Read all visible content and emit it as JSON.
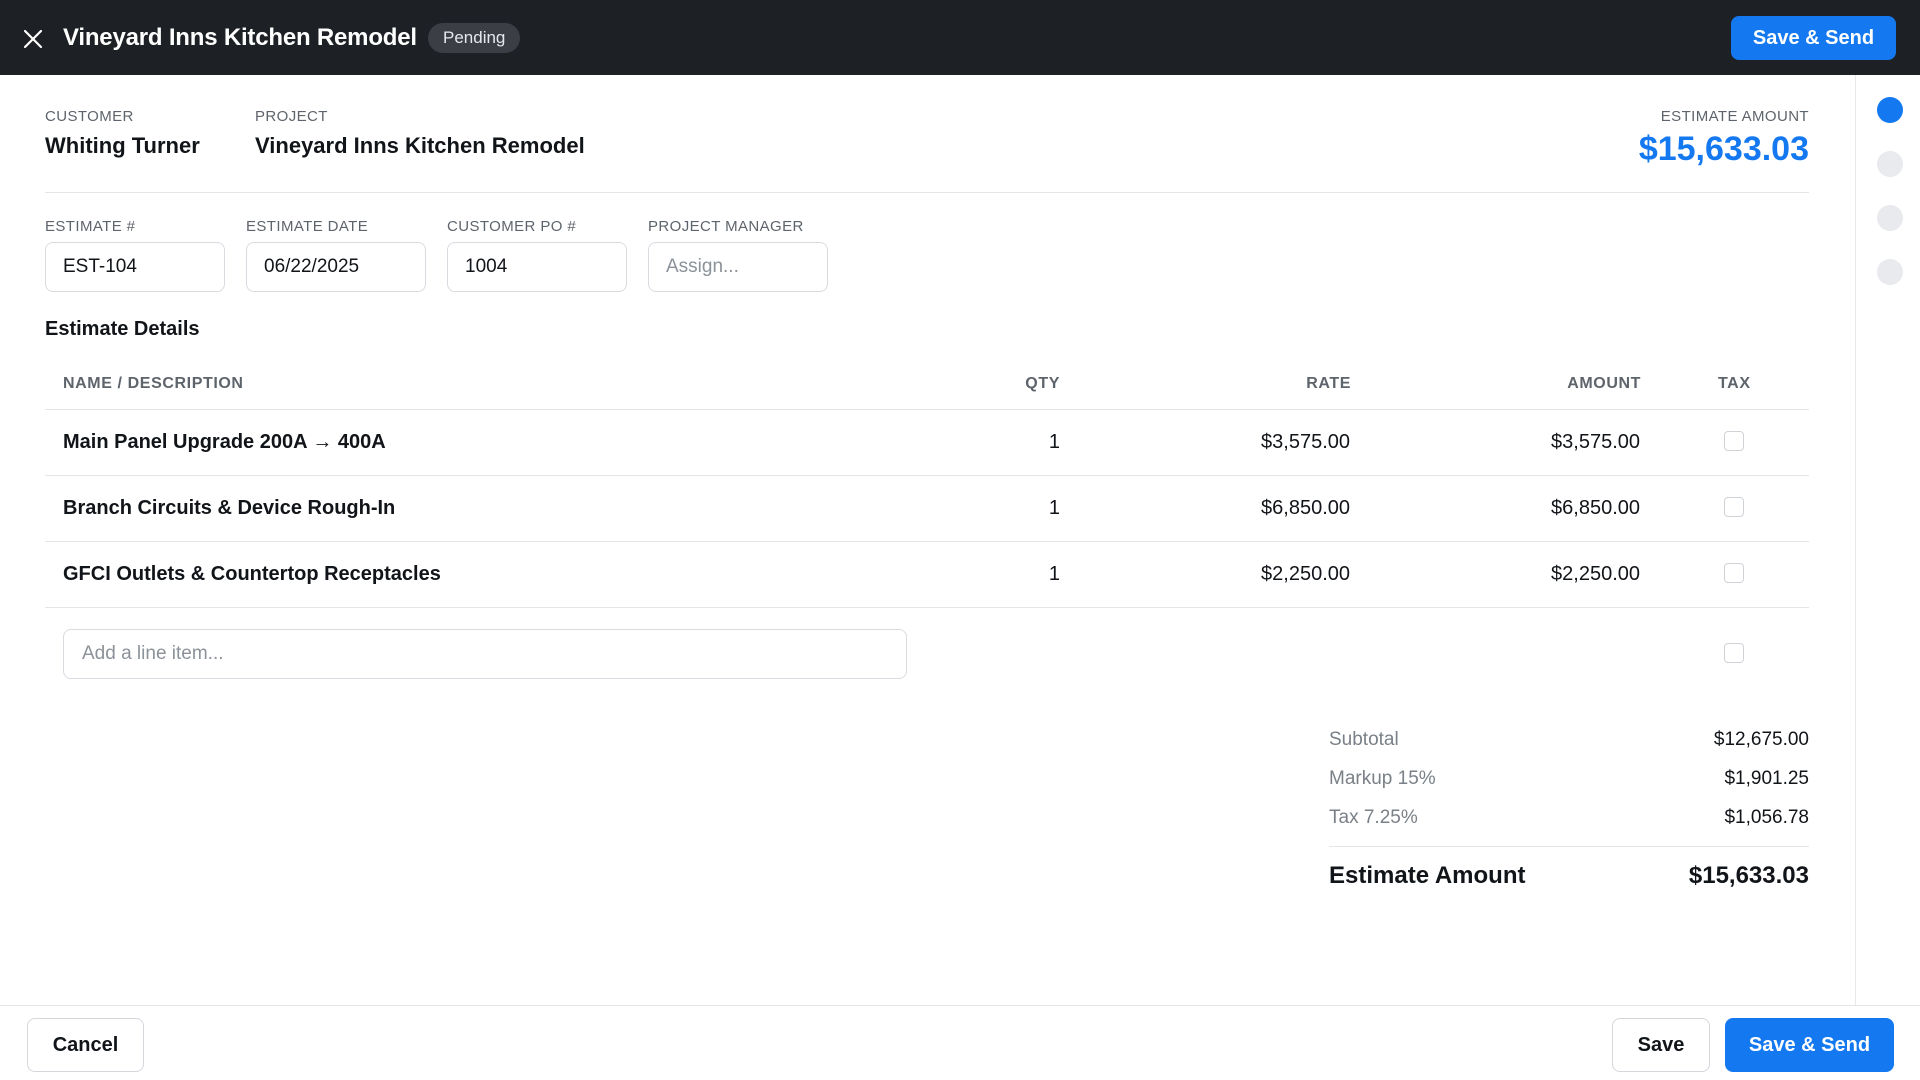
{
  "header": {
    "title": "Vineyard Inns Kitchen Remodel",
    "status": "Pending",
    "send_label": "Save & Send"
  },
  "summary": {
    "customer_label": "CUSTOMER",
    "customer": "Whiting Turner",
    "project_label": "PROJECT",
    "project": "Vineyard Inns Kitchen Remodel",
    "amount_label": "ESTIMATE AMOUNT",
    "amount": "$15,633.03"
  },
  "fields": {
    "estimate_no_label": "ESTIMATE #",
    "estimate_no": "EST-104",
    "estimate_date_label": "ESTIMATE DATE",
    "estimate_date": "06/22/2025",
    "customer_po_label": "CUSTOMER PO #",
    "customer_po": "1004",
    "pm_label": "PROJECT MANAGER",
    "pm_placeholder": "Assign..."
  },
  "details": {
    "title": "Estimate Details",
    "columns": {
      "name": "NAME / DESCRIPTION",
      "qty": "QTY",
      "rate": "RATE",
      "amount": "AMOUNT",
      "tax": "TAX"
    },
    "items": [
      {
        "name": "Main Panel Upgrade 200A → 400A",
        "qty": "1",
        "rate": "$3,575.00",
        "amount": "$3,575.00",
        "tax": false
      },
      {
        "name": "Branch Circuits & Device Rough-In",
        "qty": "1",
        "rate": "$6,850.00",
        "amount": "$6,850.00",
        "tax": false
      },
      {
        "name": "GFCI Outlets & Countertop Receptacles",
        "qty": "1",
        "rate": "$2,250.00",
        "amount": "$2,250.00",
        "tax": false
      }
    ],
    "add_line_placeholder": "Add a line item..."
  },
  "totals": {
    "subtotal_label": "Subtotal",
    "subtotal": "$12,675.00",
    "markup_label": "Markup 15%",
    "markup": "$1,901.25",
    "tax_label": "Tax 7.25%",
    "tax": "$1,056.78",
    "total_label": "Estimate Amount",
    "total": "$15,633.03"
  },
  "footer": {
    "cancel_label": "Cancel",
    "save_label": "Save",
    "send_label": "Save & Send"
  },
  "steps": {
    "active_index": 0,
    "count": 4
  },
  "colors": {
    "accent": "#1479f0",
    "header_bg": "#1d2024",
    "badge_bg": "#3b3f45"
  }
}
